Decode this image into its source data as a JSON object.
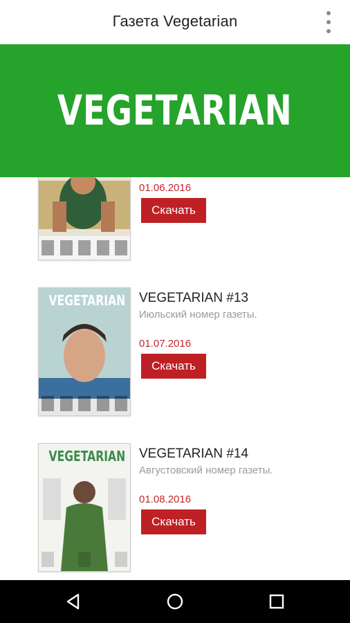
{
  "app": {
    "title": "Газета Vegetarian",
    "overflow_icon": "more-vert-icon"
  },
  "banner": {
    "text": "VEGETARIAN",
    "color": "#25a32b"
  },
  "issues": [
    {
      "title": "",
      "description": "",
      "date": "01.06.2016",
      "download_label": "Скачать",
      "cover_title": ""
    },
    {
      "title": "VEGETARIAN #13",
      "description": "Июльский номер газеты.",
      "date": "01.07.2016",
      "download_label": "Скачать",
      "cover_title": "VEGETARIAN"
    },
    {
      "title": "VEGETARIAN #14",
      "description": "Августовский номер газеты.",
      "date": "01.08.2016",
      "download_label": "Скачать",
      "cover_title": "VEGETARIAN"
    }
  ],
  "navigation": {
    "back_icon": "back-icon",
    "home_icon": "home-icon",
    "recents_icon": "recents-icon"
  },
  "colors": {
    "accent_red": "#bf2025",
    "date_red": "#c0272d"
  }
}
